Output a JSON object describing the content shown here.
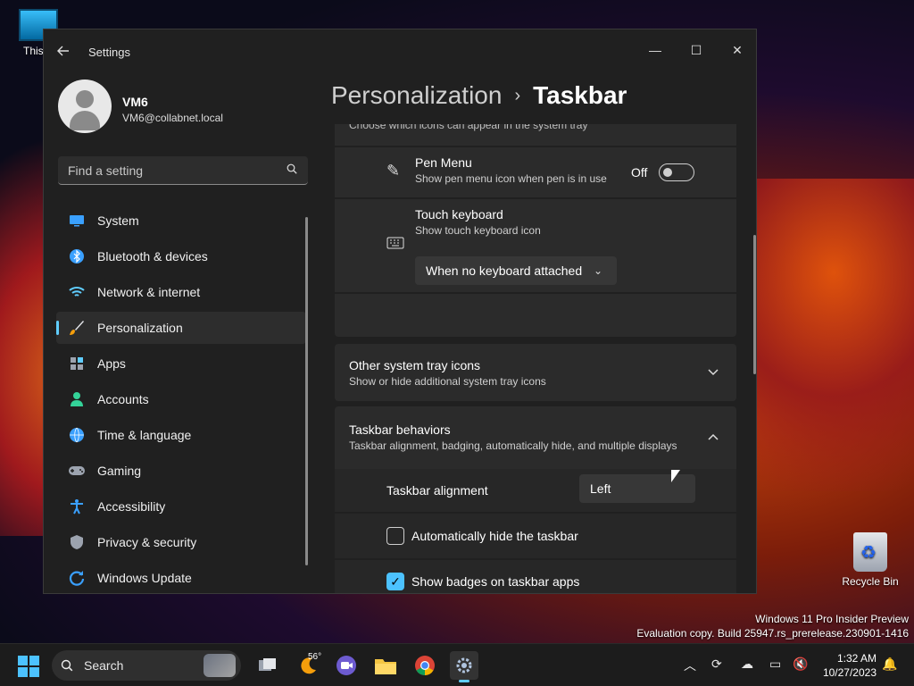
{
  "desktop": {
    "pc_label": "This P",
    "recycle_label": "Recycle Bin",
    "watermark_line1": "Windows 11 Pro Insider Preview",
    "watermark_line2": "Evaluation copy. Build 25947.rs_prerelease.230901-1416"
  },
  "window": {
    "title": "Settings",
    "controls": {
      "minimize": "—",
      "maximize": "☐",
      "close": "✕"
    }
  },
  "profile": {
    "name": "VM6",
    "email": "VM6@collabnet.local"
  },
  "search": {
    "placeholder": "Find a setting"
  },
  "nav": {
    "items": [
      {
        "label": "System",
        "icon": "monitor-icon",
        "color": "#3aa0ff"
      },
      {
        "label": "Bluetooth & devices",
        "icon": "bluetooth-icon",
        "color": "#3aa0ff"
      },
      {
        "label": "Network & internet",
        "icon": "wifi-icon",
        "color": "#60cdff"
      },
      {
        "label": "Personalization",
        "icon": "brush-icon",
        "color": "#f59e0b",
        "active": true
      },
      {
        "label": "Apps",
        "icon": "apps-icon",
        "color": "#9ca3af"
      },
      {
        "label": "Accounts",
        "icon": "person-icon",
        "color": "#34d399"
      },
      {
        "label": "Time & language",
        "icon": "globe-clock-icon",
        "color": "#3aa0ff"
      },
      {
        "label": "Gaming",
        "icon": "gamepad-icon",
        "color": "#9ca3af"
      },
      {
        "label": "Accessibility",
        "icon": "accessibility-icon",
        "color": "#3aa0ff"
      },
      {
        "label": "Privacy & security",
        "icon": "shield-icon",
        "color": "#9ca3af"
      },
      {
        "label": "Windows Update",
        "icon": "update-icon",
        "color": "#3aa0ff"
      }
    ]
  },
  "breadcrumb": {
    "parent": "Personalization",
    "separator": "›",
    "current": "Taskbar"
  },
  "content": {
    "truncated_text": "Choose which icons can appear in the system tray",
    "pen_menu": {
      "title": "Pen Menu",
      "subtitle": "Show pen menu icon when pen is in use",
      "state": "Off"
    },
    "touch_keyboard": {
      "title": "Touch keyboard",
      "subtitle": "Show touch keyboard icon",
      "dropdown_value": "When no keyboard attached"
    },
    "other_tray": {
      "title": "Other system tray icons",
      "subtitle": "Show or hide additional system tray icons"
    },
    "behaviors": {
      "title": "Taskbar behaviors",
      "subtitle": "Taskbar alignment, badging, automatically hide, and multiple displays"
    },
    "alignment": {
      "label": "Taskbar alignment",
      "value": "Left"
    },
    "auto_hide": {
      "label": "Automatically hide the taskbar",
      "checked": false
    },
    "badges": {
      "label": "Show badges on taskbar apps",
      "checked": true
    }
  },
  "taskbar": {
    "search_placeholder": "Search",
    "weather_temp": "56°",
    "time": "1:32 AM",
    "date": "10/27/2023"
  }
}
